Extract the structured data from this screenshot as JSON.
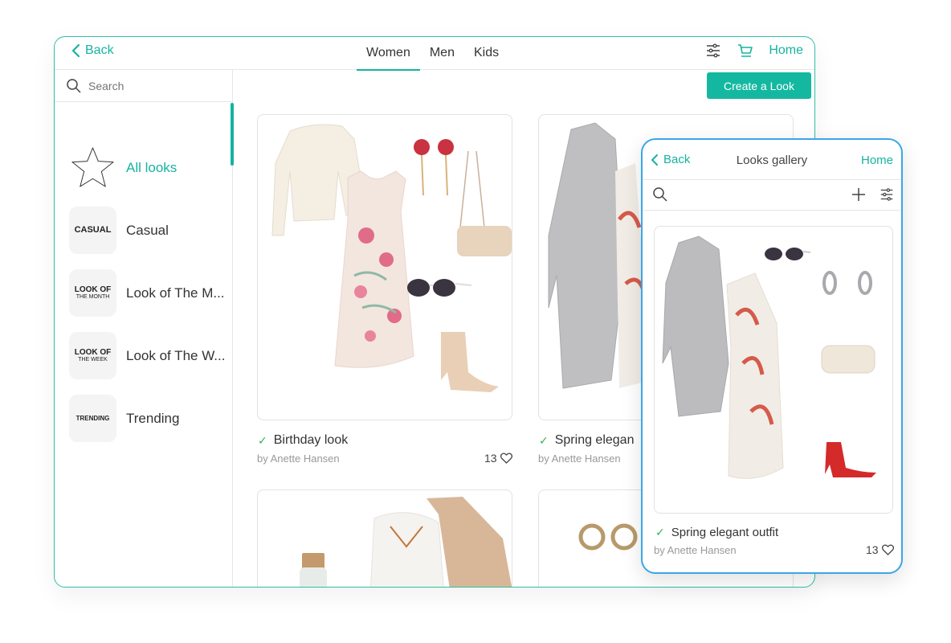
{
  "tablet": {
    "back_label": "Back",
    "tabs": [
      "Women",
      "Men",
      "Kids"
    ],
    "active_tab": "Women",
    "home_label": "Home",
    "search_placeholder": "Search",
    "create_label": "Create a Look",
    "categories": [
      {
        "label": "All looks",
        "thumb": ""
      },
      {
        "label": "Casual",
        "thumb": "CASUAL"
      },
      {
        "label": "Look of The M...",
        "thumb": "LOOK OF",
        "thumb_sub": "THE MONTH"
      },
      {
        "label": "Look of The W...",
        "thumb": "LOOK OF",
        "thumb_sub": "THE WEEK"
      },
      {
        "label": "Trending",
        "thumb": "TRENDING"
      }
    ],
    "looks": [
      {
        "title": "Birthday look",
        "author": "by Anette Hansen",
        "likes": "13"
      },
      {
        "title": "Spring elegan",
        "author": "by Anette Hansen"
      }
    ]
  },
  "phone": {
    "back_label": "Back",
    "title": "Looks gallery",
    "home_label": "Home",
    "look": {
      "title": "Spring elegant outfit",
      "author": "by Anette Hansen",
      "likes": "13"
    }
  },
  "colors": {
    "accent": "#16b3a0",
    "phone_border": "#3aa6e6",
    "check": "#37b24d"
  }
}
